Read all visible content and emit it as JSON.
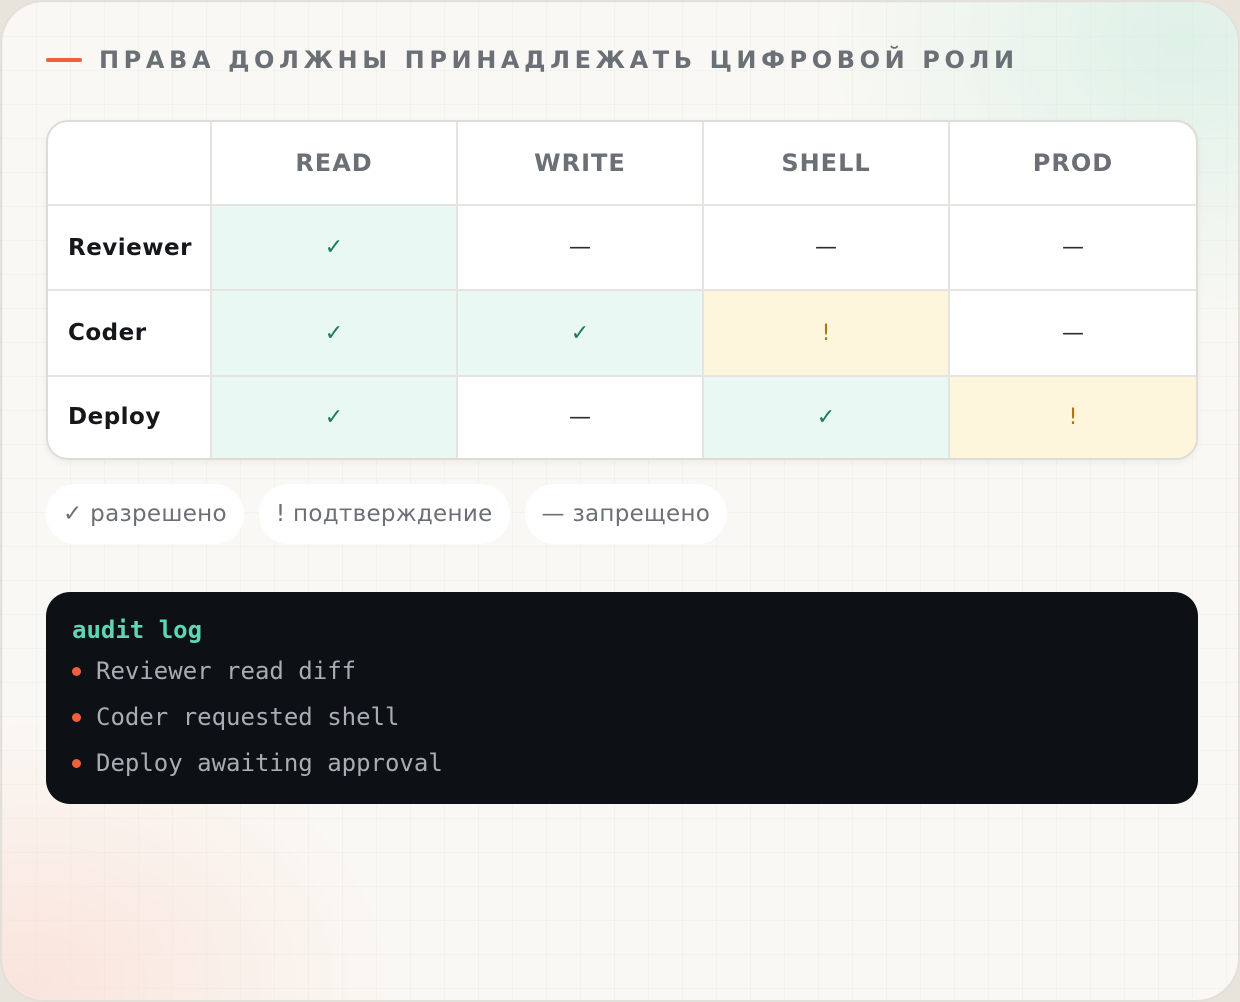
{
  "heading": "ПРАВА ДОЛЖНЫ ПРИНАДЛЕЖАТЬ ЦИФРОВОЙ РОЛИ",
  "accent_color": "#f0603c",
  "matrix": {
    "columns": [
      "READ",
      "WRITE",
      "SHELL",
      "PROD"
    ],
    "rows": [
      {
        "role": "Reviewer",
        "cells": [
          {
            "symbol": "✓",
            "status": "allow"
          },
          {
            "symbol": "—",
            "status": "deny"
          },
          {
            "symbol": "—",
            "status": "deny"
          },
          {
            "symbol": "—",
            "status": "deny"
          }
        ]
      },
      {
        "role": "Coder",
        "cells": [
          {
            "symbol": "✓",
            "status": "allow"
          },
          {
            "symbol": "✓",
            "status": "allow"
          },
          {
            "symbol": "!",
            "status": "confirm"
          },
          {
            "symbol": "—",
            "status": "deny"
          }
        ]
      },
      {
        "role": "Deploy",
        "cells": [
          {
            "symbol": "✓",
            "status": "allow"
          },
          {
            "symbol": "—",
            "status": "deny"
          },
          {
            "symbol": "✓",
            "status": "allow"
          },
          {
            "symbol": "!",
            "status": "confirm"
          }
        ]
      }
    ],
    "status_colors": {
      "allow": "#eaf8f4",
      "confirm": "#fdf6dc",
      "deny": "#ffffff"
    }
  },
  "legend": [
    {
      "text": "✓ разрешено"
    },
    {
      "text": "! подтверждение"
    },
    {
      "text": "— запрещено"
    }
  ],
  "audit_log": {
    "title": "audit log",
    "entries": [
      "Reviewer read diff",
      "Coder requested shell",
      "Deploy awaiting approval"
    ]
  }
}
